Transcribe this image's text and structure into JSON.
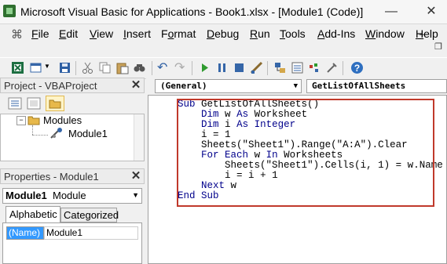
{
  "window": {
    "title": "Microsoft Visual Basic for Applications - Book1.xlsx - [Module1 (Code)]",
    "min": "—",
    "close": "✕",
    "restore": "_",
    "child_restore": "❐"
  },
  "menu": [
    {
      "label": "File",
      "u": "F",
      "rest": "ile"
    },
    {
      "label": "Edit",
      "u": "E",
      "rest": "dit"
    },
    {
      "label": "View",
      "u": "V",
      "rest": "iew"
    },
    {
      "label": "Insert",
      "u": "I",
      "rest": "nsert"
    },
    {
      "label": "Format",
      "u": "o",
      "pre": "F",
      "rest": "rmat"
    },
    {
      "label": "Debug",
      "u": "D",
      "rest": "ebug"
    },
    {
      "label": "Run",
      "u": "R",
      "rest": "un"
    },
    {
      "label": "Tools",
      "u": "T",
      "rest": "ools"
    },
    {
      "label": "Add-Ins",
      "u": "A",
      "rest": "dd-Ins"
    },
    {
      "label": "Window",
      "u": "W",
      "rest": "indow"
    },
    {
      "label": "Help",
      "u": "H",
      "rest": "elp"
    }
  ],
  "project_pane": {
    "title": "Project - VBAProject",
    "folder": "Modules",
    "module": "Module1"
  },
  "properties_pane": {
    "title": "Properties - Module1",
    "object_name": "Module1",
    "object_type": "Module",
    "tabs": [
      "Alphabetic",
      "Categorized"
    ],
    "prop_name": "(Name)",
    "prop_value": "Module1"
  },
  "code_pane": {
    "object_combo": "(General)",
    "proc_combo": "GetListOfAllSheets",
    "lines": [
      "Sub GetListOfAllSheets()",
      "    Dim w As Worksheet",
      "    Dim i As Integer",
      "    i = 1",
      "    Sheets(\"Sheet1\").Range(\"A:A\").Clear",
      "    For Each w In Worksheets",
      "        Sheets(\"Sheet1\").Cells(i, 1) = w.Name",
      "        i = i + 1",
      "    Next w",
      "End Sub"
    ]
  },
  "colors": {
    "keyword": "#00008b",
    "highlight": "#c0392b"
  }
}
